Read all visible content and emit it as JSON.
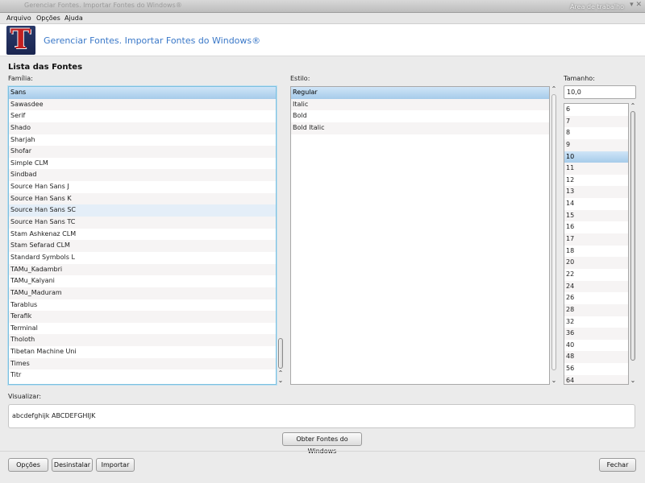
{
  "window": {
    "title": "Gerenciar Fontes. Importar Fontes do Windows®",
    "desktop_label": "Área de trabalho",
    "controls": "▾ ✕"
  },
  "menu": [
    "Arquivo",
    "Opções",
    "Ajuda"
  ],
  "banner": {
    "logo_letter": "T",
    "title": "Gerenciar Fontes. Importar Fontes do Windows®"
  },
  "section_title": "Lista das Fontes",
  "family": {
    "label": "Família:",
    "items": [
      "Sans",
      "Sawasdee",
      "Serif",
      "Shado",
      "Sharjah",
      "Shofar",
      "Simple CLM",
      "Sindbad",
      "Source Han Sans J",
      "Source Han Sans K",
      "Source Han Sans SC",
      "Source Han Sans TC",
      "Stam Ashkenaz CLM",
      "Stam Sefarad CLM",
      "Standard Symbols L",
      "TAMu_Kadambri",
      "TAMu_Kalyani",
      "TAMu_Maduram",
      "Tarablus",
      "Terafik",
      "Terminal",
      "Tholoth",
      "Tibetan Machine Uni",
      "Times",
      "Titr"
    ],
    "selected": "Sans",
    "hovered": "Source Han Sans SC"
  },
  "style": {
    "label": "Estilo:",
    "items": [
      "Regular",
      "Italic",
      "Bold",
      "Bold Italic"
    ],
    "selected": "Regular"
  },
  "size": {
    "label": "Tamanho:",
    "value": "10,0",
    "items": [
      "6",
      "7",
      "8",
      "9",
      "10",
      "11",
      "12",
      "13",
      "14",
      "15",
      "16",
      "17",
      "18",
      "20",
      "22",
      "24",
      "26",
      "28",
      "32",
      "36",
      "40",
      "48",
      "56",
      "64"
    ],
    "selected": "10"
  },
  "preview": {
    "label": "Visualizar:",
    "text": "abcdefghijk ABCDEFGHIJK"
  },
  "buttons": {
    "get_windows_fonts": "Obter Fontes do Windows",
    "options": "Opções",
    "uninstall": "Desinstalar",
    "import": "Importar",
    "close": "Fechar"
  },
  "icons": {
    "scroll_up": "scroll-up-icon",
    "scroll_down": "scroll-down-icon"
  }
}
